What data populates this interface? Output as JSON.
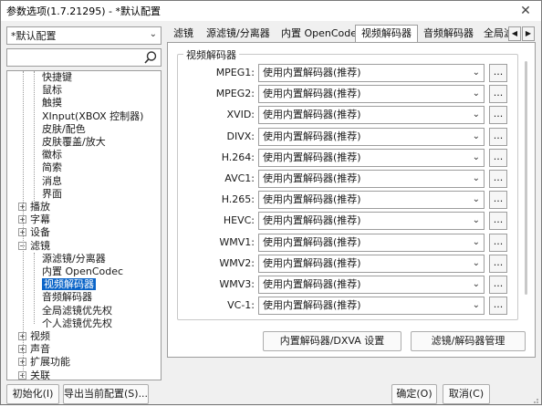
{
  "window": {
    "title": "参数选项(1.7.21295) - *默认配置"
  },
  "left": {
    "preset": "*默认配置",
    "search_placeholder": "",
    "tree": [
      {
        "label": "快捷键",
        "level": 2,
        "expander": ""
      },
      {
        "label": "鼠标",
        "level": 2,
        "expander": ""
      },
      {
        "label": "触摸",
        "level": 2,
        "expander": ""
      },
      {
        "label": "XInput(XBOX 控制器)",
        "level": 2,
        "expander": ""
      },
      {
        "label": "皮肤/配色",
        "level": 2,
        "expander": ""
      },
      {
        "label": "皮肤覆盖/放大",
        "level": 2,
        "expander": ""
      },
      {
        "label": "徽标",
        "level": 2,
        "expander": ""
      },
      {
        "label": "简索",
        "level": 2,
        "expander": ""
      },
      {
        "label": "消息",
        "level": 2,
        "expander": ""
      },
      {
        "label": "界面",
        "level": 2,
        "expander": ""
      },
      {
        "label": "播放",
        "level": 1,
        "expander": "+"
      },
      {
        "label": "字幕",
        "level": 1,
        "expander": "+"
      },
      {
        "label": "设备",
        "level": 1,
        "expander": "+"
      },
      {
        "label": "滤镜",
        "level": 1,
        "expander": "-"
      },
      {
        "label": "源滤镜/分离器",
        "level": 2,
        "expander": ""
      },
      {
        "label": "内置 OpenCodec",
        "level": 2,
        "expander": ""
      },
      {
        "label": "视频解码器",
        "level": 2,
        "expander": "",
        "selected": true
      },
      {
        "label": "音频解码器",
        "level": 2,
        "expander": ""
      },
      {
        "label": "全局滤镜优先权",
        "level": 2,
        "expander": ""
      },
      {
        "label": "个人滤镜优先权",
        "level": 2,
        "expander": ""
      },
      {
        "label": "视频",
        "level": 1,
        "expander": "+"
      },
      {
        "label": "声音",
        "level": 1,
        "expander": "+"
      },
      {
        "label": "扩展功能",
        "level": 1,
        "expander": "+"
      },
      {
        "label": "关联",
        "level": 1,
        "expander": "+"
      }
    ]
  },
  "tabs": [
    {
      "label": "滤镜",
      "active": false
    },
    {
      "label": "源滤镜/分离器",
      "active": false
    },
    {
      "label": "内置 OpenCodec",
      "active": false
    },
    {
      "label": "视频解码器",
      "active": true
    },
    {
      "label": "音频解码器",
      "active": false
    },
    {
      "label": "全局滤",
      "active": false
    }
  ],
  "group": {
    "title": "视频解码器",
    "rows": [
      {
        "label": "MPEG1:",
        "value": "使用内置解码器(推荐)"
      },
      {
        "label": "MPEG2:",
        "value": "使用内置解码器(推荐)"
      },
      {
        "label": "XVID:",
        "value": "使用内置解码器(推荐)"
      },
      {
        "label": "DIVX:",
        "value": "使用内置解码器(推荐)"
      },
      {
        "label": "H.264:",
        "value": "使用内置解码器(推荐)"
      },
      {
        "label": "AVC1:",
        "value": "使用内置解码器(推荐)"
      },
      {
        "label": "H.265:",
        "value": "使用内置解码器(推荐)"
      },
      {
        "label": "HEVC:",
        "value": "使用内置解码器(推荐)"
      },
      {
        "label": "WMV1:",
        "value": "使用内置解码器(推荐)"
      },
      {
        "label": "WMV2:",
        "value": "使用内置解码器(推荐)"
      },
      {
        "label": "WMV3:",
        "value": "使用内置解码器(推荐)"
      },
      {
        "label": "VC-1:",
        "value": "使用内置解码器(推荐)"
      }
    ],
    "more_label": "...",
    "btn_dxva": "内置解码器/DXVA 设置",
    "btn_manage": "滤镜/解码器管理"
  },
  "bottom": {
    "init": "初始化(I)",
    "export": "导出当前配置(S)...",
    "ok": "确定(O)",
    "cancel": "取消(C)"
  },
  "colors": {
    "selection": "#0a64c8"
  }
}
